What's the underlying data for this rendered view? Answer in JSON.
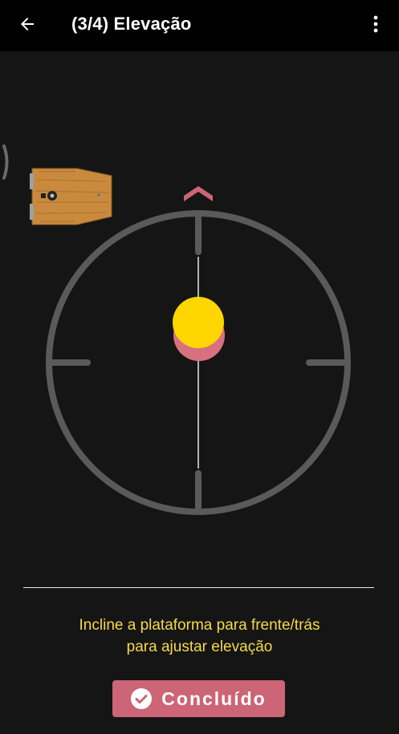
{
  "header": {
    "title": "(3/4) Elevação",
    "back_icon": "arrow-left-icon",
    "menu_icon": "more-vertical-icon"
  },
  "instrument": {
    "up_indicator_icon": "chevron-up-icon",
    "bubble_color": "#ffd600",
    "target_color": "#d9707f",
    "ring_color": "#5a5a5a"
  },
  "instruction": {
    "line1": "Incline a plataforma para frente/trás",
    "line2": "para ajustar elevação"
  },
  "done_button": {
    "label": "Concluído",
    "icon": "check-circle-icon",
    "color": "#cc6576"
  }
}
